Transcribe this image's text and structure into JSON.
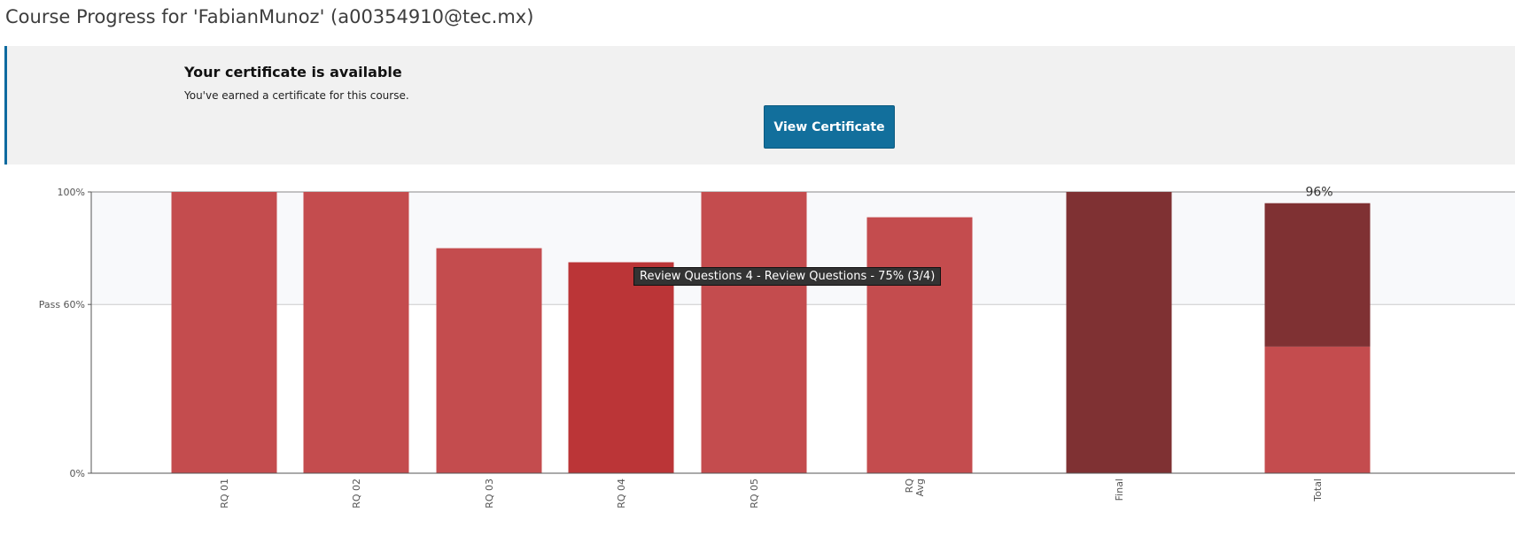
{
  "page": {
    "title": "Course Progress for 'FabianMunoz' (a00354910@tec.mx)"
  },
  "certificate": {
    "heading": "Your certificate is available",
    "description": "You've earned a certificate for this course.",
    "button_label": "View Certificate"
  },
  "chart_data": {
    "type": "bar",
    "y_ticks": [
      {
        "value": 100,
        "label": "100%"
      },
      {
        "value": 60,
        "label": "Pass 60%"
      },
      {
        "value": 0,
        "label": "0%"
      }
    ],
    "ylim": [
      0,
      100
    ],
    "grid": false,
    "pass_threshold": 60,
    "bars": [
      {
        "category": "RQ 01",
        "value": 100,
        "color": "#c44c4e"
      },
      {
        "category": "RQ 02",
        "value": 100,
        "color": "#c44c4e"
      },
      {
        "category": "RQ 03",
        "value": 80,
        "color": "#c44c4e"
      },
      {
        "category": "RQ 04",
        "value": 75,
        "color": "#bb3537"
      },
      {
        "category": "RQ 05",
        "value": 100,
        "color": "#c44c4e"
      },
      {
        "category": "RQ\nAvg",
        "value": 91,
        "color": "#c44c4e"
      },
      {
        "category": "Final",
        "value": 100,
        "color": "#7f3133"
      },
      {
        "category": "Total",
        "segments": [
          {
            "value": 45,
            "color": "#c44c4e"
          },
          {
            "value": 51,
            "color": "#7f3133"
          }
        ],
        "value_label": "96%"
      }
    ],
    "tooltip": "Review Questions 4 - Review Questions - 75% (3/4)",
    "colors": {
      "pass_band": "#f8f9fb",
      "axis": "#555555",
      "pass_line": "#cccccc"
    }
  }
}
